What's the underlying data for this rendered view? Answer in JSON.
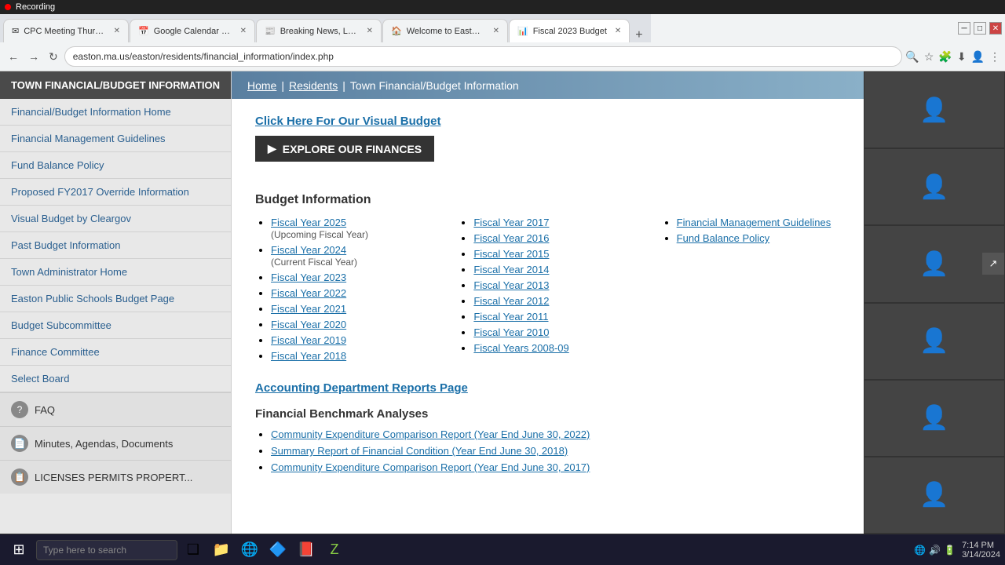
{
  "recording": {
    "label": "Recording"
  },
  "browser": {
    "tabs": [
      {
        "id": "tab1",
        "favicon": "✉",
        "label": "CPC Meeting Thursday March...",
        "active": false,
        "color": "#d44"
      },
      {
        "id": "tab2",
        "favicon": "📅",
        "label": "Google Calendar - Week of M...",
        "active": false,
        "color": "#4a8"
      },
      {
        "id": "tab3",
        "favicon": "📰",
        "label": "Breaking News, Latest News ...",
        "active": false,
        "color": "#e44"
      },
      {
        "id": "tab4",
        "favicon": "🏠",
        "label": "Welcome to Easton, MA",
        "active": false,
        "color": "#4a8"
      },
      {
        "id": "tab5",
        "favicon": "📊",
        "label": "Fiscal 2023 Budget",
        "active": true,
        "color": "#4a8"
      }
    ],
    "url": "easton.ma.us/easton/residents/financial_information/index.php"
  },
  "breadcrumb": {
    "home": "Home",
    "sep1": "|",
    "residents": "Residents",
    "sep2": "|",
    "current": "Town Financial/Budget Information"
  },
  "sidebar": {
    "section_title": "TOWN FINANCIAL/BUDGET INFORMATION",
    "items": [
      {
        "label": "Financial/Budget Information Home",
        "id": "financial-home"
      },
      {
        "label": "Financial Management Guidelines",
        "id": "financial-guidelines"
      },
      {
        "label": "Fund Balance Policy",
        "id": "fund-balance-policy"
      },
      {
        "label": "Proposed FY2017 Override Information",
        "id": "fy2017-override"
      },
      {
        "label": "Visual Budget by Cleargov",
        "id": "visual-budget-cleargov"
      },
      {
        "label": "Past Budget Information",
        "id": "past-budget"
      },
      {
        "label": "Town Administrator Home",
        "id": "town-admin-home"
      },
      {
        "label": "Easton Public Schools Budget Page",
        "id": "schools-budget"
      },
      {
        "label": "Budget Subcommittee",
        "id": "budget-subcommittee"
      },
      {
        "label": "Finance Committee",
        "id": "finance-committee"
      },
      {
        "label": "Select Board",
        "id": "select-board"
      }
    ],
    "bottom_items": [
      {
        "label": "FAQ",
        "icon": "?",
        "id": "faq"
      },
      {
        "label": "Minutes, Agendas, Documents",
        "icon": "📄",
        "id": "minutes"
      },
      {
        "label": "LICENSES PERMITS PROPERT...",
        "icon": "📋",
        "id": "licenses"
      }
    ]
  },
  "content": {
    "visual_budget_link": "Click Here For Our Visual Budget",
    "explore_btn": "EXPLORE OUR FINANCES",
    "budget_section_title": "Budget Information",
    "current_fiscal": [
      {
        "year": "Fiscal Year 2025",
        "sublabel": "(Upcoming Fiscal Year)"
      },
      {
        "year": "Fiscal Year 2024",
        "sublabel": "(Current Fiscal Year)"
      },
      {
        "year": "Fiscal Year 2023",
        "sublabel": ""
      },
      {
        "year": "Fiscal Year 2022",
        "sublabel": ""
      },
      {
        "year": "Fiscal Year 2021",
        "sublabel": ""
      },
      {
        "year": "Fiscal Year 2020",
        "sublabel": ""
      },
      {
        "year": "Fiscal Year 2019",
        "sublabel": ""
      },
      {
        "year": "Fiscal Year 2018",
        "sublabel": ""
      }
    ],
    "past_fiscal": [
      {
        "year": "Fiscal Year 2017"
      },
      {
        "year": "Fiscal Year 2016"
      },
      {
        "year": "Fiscal Year 2015"
      },
      {
        "year": "Fiscal Year 2014"
      },
      {
        "year": "Fiscal Year 2013"
      },
      {
        "year": "Fiscal Year 2012"
      },
      {
        "year": "Fiscal Year 2011"
      },
      {
        "year": "Fiscal Year 2010"
      },
      {
        "year": "Fiscal Years 2008-09"
      }
    ],
    "policy_links": [
      {
        "label": "Financial Management Guidelines"
      },
      {
        "label": "Fund Balance Policy"
      }
    ],
    "accounting_link": "Accounting Department Reports Page",
    "benchmark_title": "Financial Benchmark Analyses",
    "benchmark_items": [
      {
        "label": "Community Expenditure Comparison Report (Year End June 30, 2022)"
      },
      {
        "label": "Summary Report of Financial Condition (Year End June 30, 2018)"
      },
      {
        "label": "Community Expenditure Comparison Report (Year End June 30, 2017)"
      }
    ]
  },
  "taskbar": {
    "search_placeholder": "Type here to search",
    "time": "7:14 PM",
    "date": "3/14/2024"
  },
  "colors": {
    "sidebar_bg": "#e8e8e8",
    "sidebar_header": "#4a4a4a",
    "link_blue": "#1a6fa8",
    "content_bg": "#ffffff"
  }
}
